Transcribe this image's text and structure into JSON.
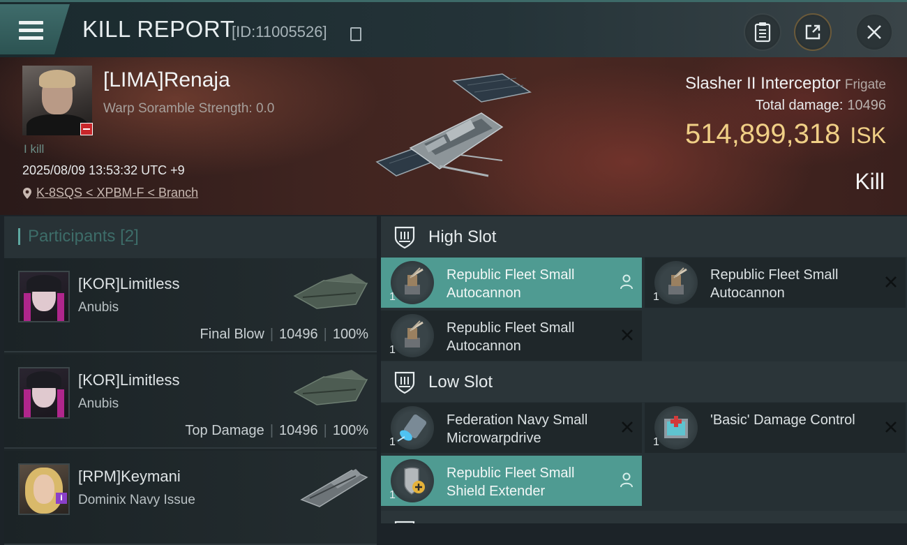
{
  "header": {
    "title": "KILL REPORT",
    "report_id": "[ID:11005526]",
    "icons": [
      "menu-icon",
      "copy-icon",
      "clipboard-icon",
      "share-icon",
      "close-icon"
    ]
  },
  "victim": {
    "name": "[LIMA]Renaja",
    "warp_scramble": "Warp Soramble Strength: 0.0",
    "kills": "I kill",
    "time": "2025/08/09 13:53:32 UTC +9",
    "location": "K-8SQS < XPBM-F < Branch",
    "ship_name": "Slasher II Interceptor",
    "ship_class": "Frigate",
    "total_damage_label": "Total damage:",
    "total_damage": "10496",
    "isk_value": "514,899,318",
    "isk_unit": "ISK",
    "result": "Kill"
  },
  "participants": {
    "title": "Participants",
    "count": "[2]",
    "items": [
      {
        "name": "[KOR]Limitless",
        "ship": "Anubis",
        "role": "Final Blow",
        "damage": "10496",
        "percent": "100%"
      },
      {
        "name": "[KOR]Limitless",
        "ship": "Anubis",
        "role": "Top Damage",
        "damage": "10496",
        "percent": "100%"
      },
      {
        "name": "[RPM]Keymani",
        "ship": "Dominix Navy Issue",
        "role": "",
        "damage": "",
        "percent": ""
      }
    ]
  },
  "fitting": {
    "high_slot": {
      "label": "High Slot",
      "modules": [
        {
          "name": "Republic Fleet Small Autocannon",
          "qty": "1",
          "status": "fitted",
          "highlight": true
        },
        {
          "name": "Republic Fleet Small Autocannon",
          "qty": "1",
          "status": "destroyed",
          "highlight": false
        },
        {
          "name": "Republic Fleet Small Autocannon",
          "qty": "1",
          "status": "destroyed",
          "highlight": false
        }
      ]
    },
    "low_slot": {
      "label": "Low Slot",
      "modules": [
        {
          "name": "Federation Navy Small Microwarpdrive",
          "qty": "1",
          "status": "destroyed",
          "highlight": false
        },
        {
          "name": "'Basic' Damage Control",
          "qty": "1",
          "status": "destroyed",
          "highlight": false
        },
        {
          "name": "Republic Fleet Small Shield Extender",
          "qty": "1",
          "status": "fitted",
          "highlight": true
        }
      ]
    }
  },
  "colors": {
    "accent_teal": "#4f9b92",
    "isk_gold": "#f0cf86",
    "menu_teal": "#3f6c6b"
  }
}
